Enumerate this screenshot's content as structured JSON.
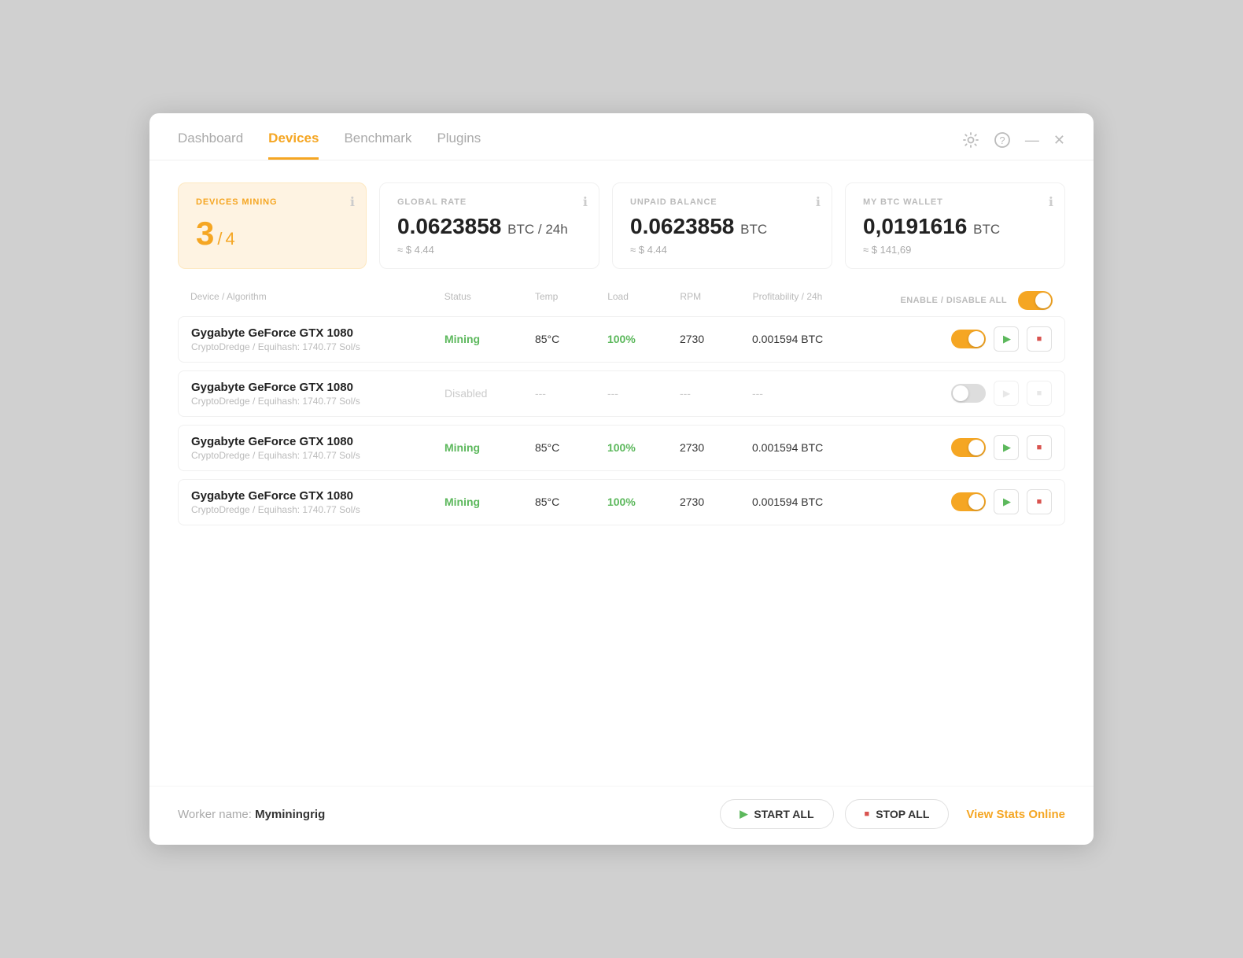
{
  "nav": {
    "tabs": [
      {
        "id": "dashboard",
        "label": "Dashboard",
        "active": false
      },
      {
        "id": "devices",
        "label": "Devices",
        "active": true
      },
      {
        "id": "benchmark",
        "label": "Benchmark",
        "active": false
      },
      {
        "id": "plugins",
        "label": "Plugins",
        "active": false
      }
    ],
    "actions": {
      "settings": "⚙",
      "help": "?",
      "minimize": "—",
      "close": "✕"
    }
  },
  "stats": {
    "devices_mining": {
      "label": "DEVICES MINING",
      "current": "3",
      "total": "4"
    },
    "global_rate": {
      "label": "GLOBAL RATE",
      "value": "0.0623858",
      "unit": "BTC",
      "period": "/ 24h",
      "usd": "≈ $ 4.44"
    },
    "unpaid_balance": {
      "label": "UNPAID BALANCE",
      "value": "0.0623858",
      "unit": "BTC",
      "usd": "≈ $ 4.44"
    },
    "btc_wallet": {
      "label": "MY BTC WALLET",
      "value": "0,0191616",
      "unit": "BTC",
      "usd": "≈ $ 141,69"
    }
  },
  "table": {
    "headers": {
      "device": "Device / Algorithm",
      "status": "Status",
      "temp": "Temp",
      "load": "Load",
      "rpm": "RPM",
      "profit": "Profitability / 24h",
      "enable_disable": "ENABLE / DISABLE ALL"
    },
    "rows": [
      {
        "id": 1,
        "name": "Gygabyte GeForce GTX 1080",
        "algo": "CryptoDredge / Equihash: 1740.77 Sol/s",
        "status": "Mining",
        "status_type": "mining",
        "temp": "85°C",
        "load": "100%",
        "load_type": "green",
        "rpm": "2730",
        "profit": "0.001594 BTC",
        "toggle": "on",
        "play_active": true,
        "stop_active": true
      },
      {
        "id": 2,
        "name": "Gygabyte GeForce GTX 1080",
        "algo": "CryptoDredge / Equihash: 1740.77 Sol/s",
        "status": "Disabled",
        "status_type": "disabled",
        "temp": "---",
        "load": "---",
        "load_type": "dash",
        "rpm": "---",
        "profit": "---",
        "toggle": "off",
        "play_active": false,
        "stop_active": false
      },
      {
        "id": 3,
        "name": "Gygabyte GeForce GTX 1080",
        "algo": "CryptoDredge / Equihash: 1740.77 Sol/s",
        "status": "Mining",
        "status_type": "mining",
        "temp": "85°C",
        "load": "100%",
        "load_type": "green",
        "rpm": "2730",
        "profit": "0.001594 BTC",
        "toggle": "on",
        "play_active": true,
        "stop_active": true
      },
      {
        "id": 4,
        "name": "Gygabyte GeForce GTX 1080",
        "algo": "CryptoDredge / Equihash: 1740.77 Sol/s",
        "status": "Mining",
        "status_type": "mining",
        "temp": "85°C",
        "load": "100%",
        "load_type": "green",
        "rpm": "2730",
        "profit": "0.001594 BTC",
        "toggle": "on",
        "play_active": true,
        "stop_active": true
      }
    ]
  },
  "footer": {
    "worker_prefix": "Worker name:",
    "worker_name": "Myminingrig",
    "start_all": "START ALL",
    "stop_all": "STOP ALL",
    "view_stats": "View Stats Online"
  }
}
